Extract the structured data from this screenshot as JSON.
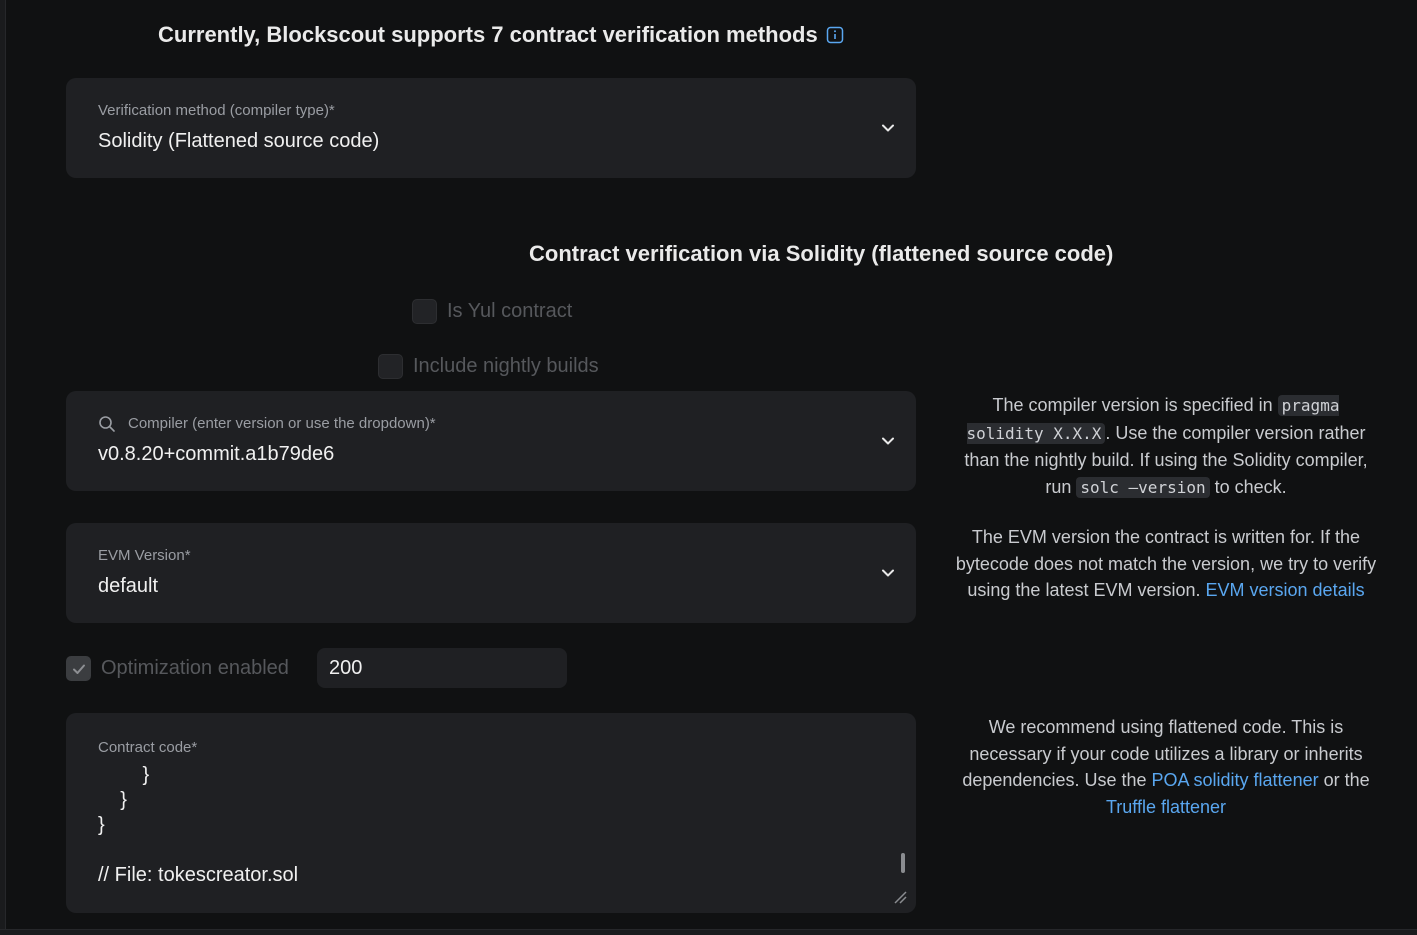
{
  "header": {
    "title": "Currently, Blockscout supports 7 contract verification methods",
    "info_icon": "info-icon"
  },
  "method_select": {
    "label": "Verification method (compiler type)*",
    "value": "Solidity (Flattened source code)"
  },
  "section": {
    "title": "Contract verification via Solidity (flattened source code)"
  },
  "checkboxes": {
    "is_yul": {
      "label": "Is Yul contract",
      "checked": false
    },
    "nightly": {
      "label": "Include nightly builds",
      "checked": false
    }
  },
  "compiler_select": {
    "label": "Compiler (enter version or use the dropdown)*",
    "value": "v0.8.20+commit.a1b79de6"
  },
  "evm_select": {
    "label": "EVM Version*",
    "value": "default"
  },
  "optimization": {
    "label": "Optimization enabled",
    "checked": true,
    "runs": "200"
  },
  "contract_code": {
    "label": "Contract code*",
    "lines": [
      "        }",
      "    }",
      "}",
      "",
      "// File: tokescreator.sol"
    ]
  },
  "help": {
    "compiler": {
      "text1": "The compiler version is specified in ",
      "code1": "pragma solidity X.X.X",
      "text2": ". Use the compiler version rather than the nightly build. If using the Solidity compiler, run ",
      "code2": "solc —version",
      "text3": " to check."
    },
    "evm": {
      "text1": "The EVM version the contract is written for. If the bytecode does not match the version, we try to verify using the latest EVM version. ",
      "link": "EVM version details"
    },
    "code": {
      "text1": "We recommend using flattened code. This is necessary if your code utilizes a library or inherits dependencies. Use the ",
      "link1": "POA solidity flattener",
      "text2": " or the ",
      "link2": "Truffle flattener"
    }
  },
  "colors": {
    "background": "#101112",
    "field": "#1f2023",
    "link": "#5aa7f0"
  }
}
